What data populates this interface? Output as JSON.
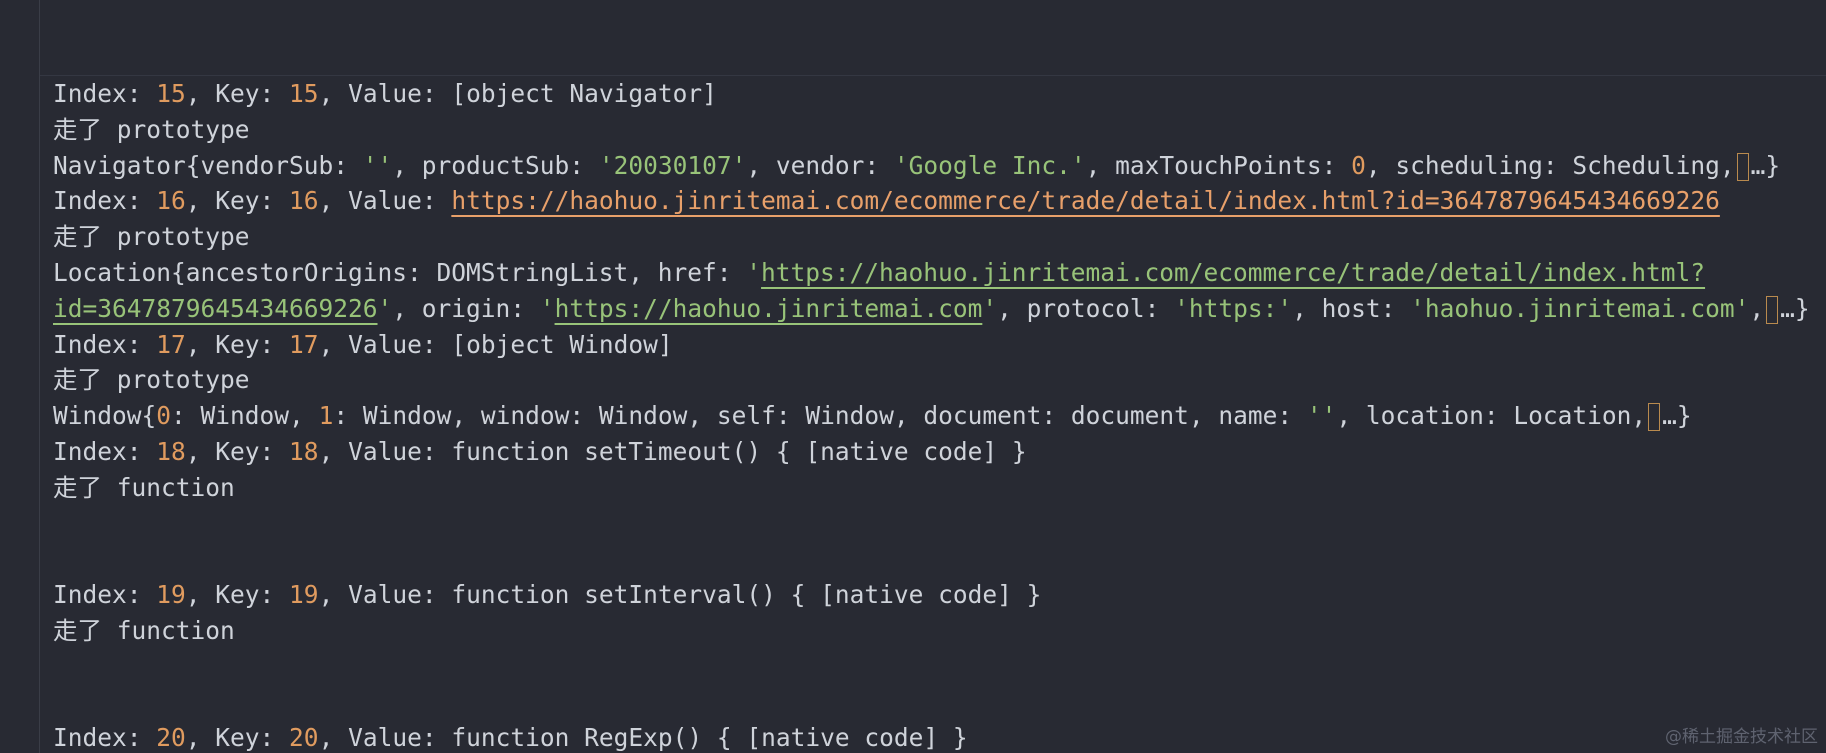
{
  "lines": [
    {
      "kind": "index",
      "index": "15",
      "key": "15",
      "value_text": "[object Navigator]"
    },
    {
      "kind": "note",
      "text": "走了 prototype"
    },
    {
      "kind": "obj",
      "name": "Navigator",
      "segments": [
        {
          "t": "p",
          "v": "{vendorSub: "
        },
        {
          "t": "s",
          "v": "''"
        },
        {
          "t": "p",
          "v": ", productSub: "
        },
        {
          "t": "s",
          "v": "'20030107'"
        },
        {
          "t": "p",
          "v": ", vendor: "
        },
        {
          "t": "s",
          "v": "'Google Inc.'"
        },
        {
          "t": "p",
          "v": ", maxTouchPoints: "
        },
        {
          "t": "n",
          "v": "0"
        },
        {
          "t": "p",
          "v": ", scheduling: Scheduling,"
        },
        {
          "t": "box"
        },
        {
          "t": "p",
          "v": "…}"
        }
      ]
    },
    {
      "kind": "index-url",
      "index": "16",
      "key": "16",
      "url": "https://haohuo.jinritemai.com/ecommerce/trade/detail/index.html?id=3647879645434669226"
    },
    {
      "kind": "note",
      "text": "走了 prototype"
    },
    {
      "kind": "obj",
      "name": "Location",
      "segments": [
        {
          "t": "p",
          "v": "{ancestorOrigins: DOMStringList, href: "
        },
        {
          "t": "s",
          "v": "'"
        },
        {
          "t": "u",
          "v": "https://haohuo.jinritemai.com/ecommerce/trade/detail/index.html?"
        }
      ]
    },
    {
      "kind": "cont",
      "segments": [
        {
          "t": "u",
          "v": "id=3647879645434669226"
        },
        {
          "t": "s",
          "v": "'"
        },
        {
          "t": "p",
          "v": ", origin: "
        },
        {
          "t": "s",
          "v": "'"
        },
        {
          "t": "u",
          "v": "https://haohuo.jinritemai.com"
        },
        {
          "t": "s",
          "v": "'"
        },
        {
          "t": "p",
          "v": ", protocol: "
        },
        {
          "t": "s",
          "v": "'https:'"
        },
        {
          "t": "p",
          "v": ", host: "
        },
        {
          "t": "s",
          "v": "'haohuo.jinritemai.com'"
        },
        {
          "t": "p",
          "v": ","
        },
        {
          "t": "box"
        },
        {
          "t": "p",
          "v": "…}"
        }
      ]
    },
    {
      "kind": "index",
      "index": "17",
      "key": "17",
      "value_text": "[object Window]"
    },
    {
      "kind": "note",
      "text": "走了 prototype"
    },
    {
      "kind": "obj",
      "name": "Window",
      "segments": [
        {
          "t": "p",
          "v": "{"
        },
        {
          "t": "n",
          "v": "0"
        },
        {
          "t": "p",
          "v": ": Window, "
        },
        {
          "t": "n",
          "v": "1"
        },
        {
          "t": "p",
          "v": ": Window, window: Window, self: Window, document: document, name: "
        },
        {
          "t": "s",
          "v": "''"
        },
        {
          "t": "p",
          "v": ", location: Location,"
        },
        {
          "t": "box"
        },
        {
          "t": "p",
          "v": "…}"
        }
      ]
    },
    {
      "kind": "index",
      "index": "18",
      "key": "18",
      "value_text": "function setTimeout() { [native code] }"
    },
    {
      "kind": "note",
      "text": "走了 function"
    },
    {
      "kind": "blank"
    },
    {
      "kind": "blank"
    },
    {
      "kind": "index",
      "index": "19",
      "key": "19",
      "value_text": "function setInterval() { [native code] }"
    },
    {
      "kind": "note",
      "text": "走了 function"
    },
    {
      "kind": "blank"
    },
    {
      "kind": "blank"
    },
    {
      "kind": "index",
      "index": "20",
      "key": "20",
      "value_text": "function RegExp() { [native code] }"
    }
  ],
  "labels": {
    "index_prefix": "Index: ",
    "key_prefix": ", Key: ",
    "value_prefix": ", Value: "
  },
  "watermark": "@稀土掘金技术社区",
  "colors": {
    "background": "#282a33",
    "text": "#cfd3da",
    "number": "#e09b5f",
    "string": "#98c379",
    "url_orange": "#e8a06a"
  }
}
